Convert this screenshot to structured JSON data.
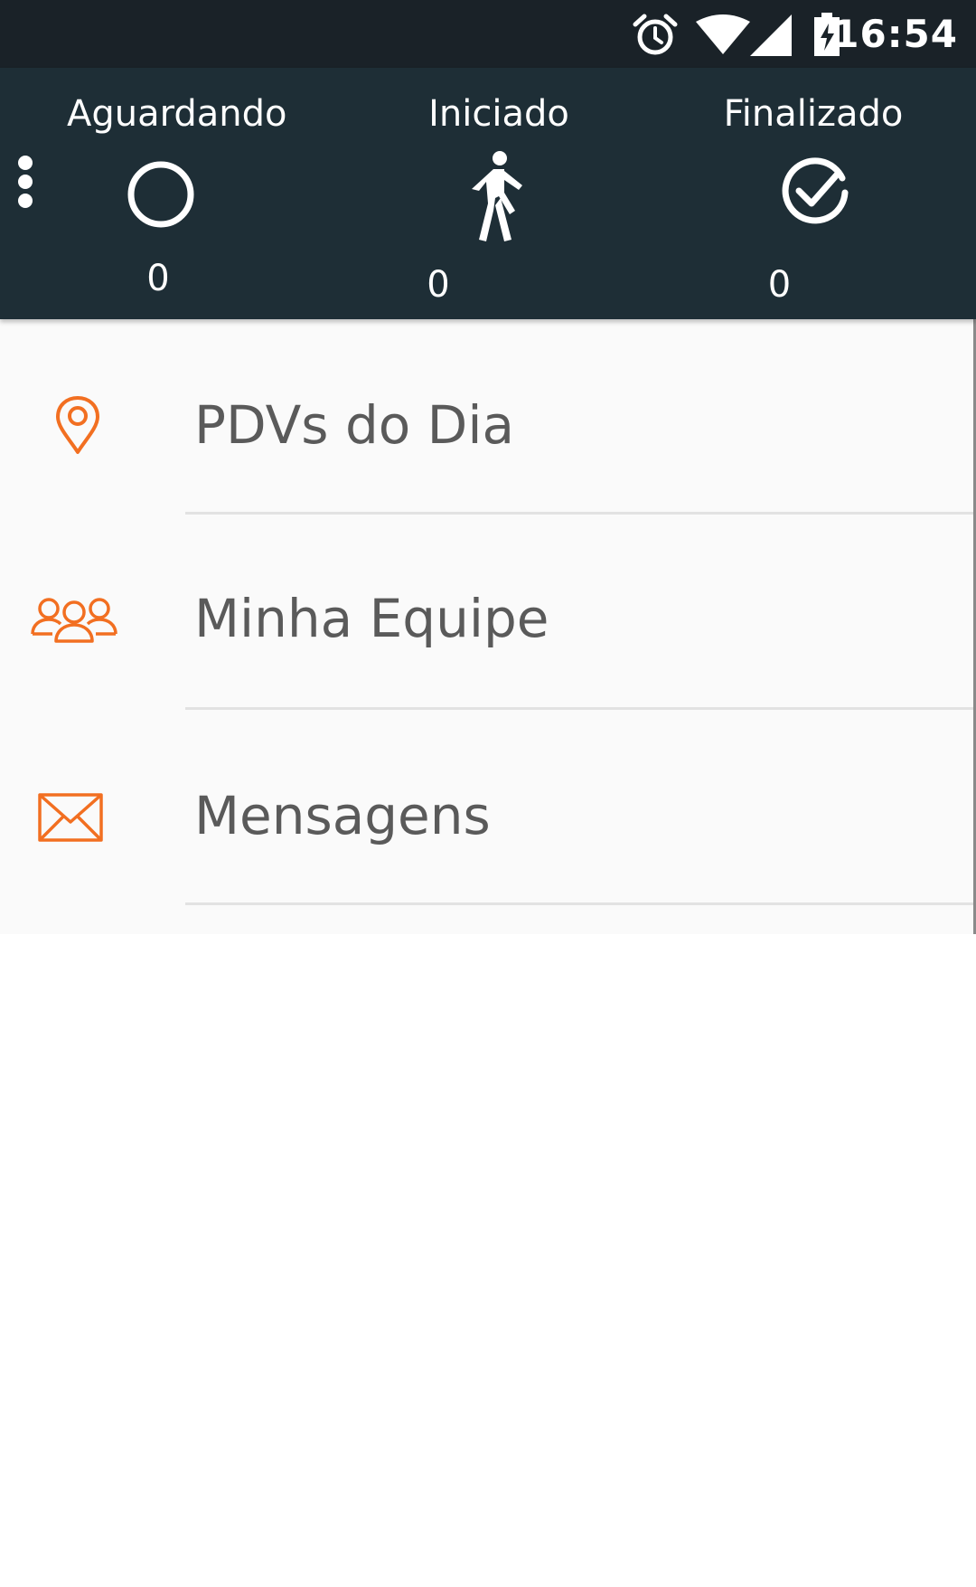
{
  "status_bar": {
    "time": "16:54",
    "icons": [
      "alarm-icon",
      "wifi-icon",
      "cellular-signal-icon",
      "battery-charging-icon"
    ]
  },
  "header": {
    "menu_icon": "overflow-menu-icon",
    "statuses": [
      {
        "label": "Aguardando",
        "icon": "circle-icon",
        "count": "0"
      },
      {
        "label": "Iniciado",
        "icon": "walking-person-icon",
        "count": "0"
      },
      {
        "label": "Finalizado",
        "icon": "check-circle-icon",
        "count": "0"
      }
    ]
  },
  "menu": {
    "items": [
      {
        "label": "PDVs do Dia",
        "icon": "map-pin-icon"
      },
      {
        "label": "Minha Equipe",
        "icon": "team-icon"
      },
      {
        "label": "Mensagens",
        "icon": "envelope-icon"
      }
    ]
  },
  "colors": {
    "status_bar_bg": "#1a2228",
    "header_bg": "#1e2e36",
    "accent_orange": "#f26f21",
    "menu_text": "#5a5a5a",
    "menu_bg": "#fafafa"
  }
}
